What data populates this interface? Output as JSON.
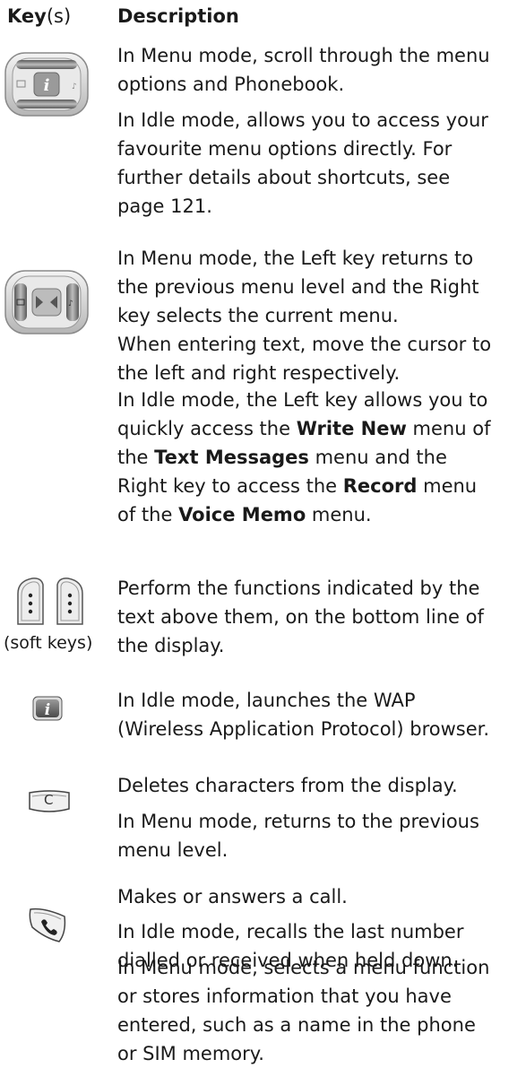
{
  "header": {
    "key_bold": "Key",
    "key_suffix": "(s)",
    "description": "Description"
  },
  "rows": {
    "nav_updown": {
      "p1": "In Menu mode, scroll through the menu\noptions and Phonebook.",
      "p2": "In Idle mode, allows you to access your\nfavourite menu options directly. For\nfurther details about shortcuts, see\npage 121."
    },
    "nav_leftright": {
      "p1": "In Menu mode, the Left key returns to\nthe previous menu level and the Right\nkey selects the current menu.\nWhen entering text, move the cursor to\nthe left and right respectively.",
      "p2_a": "In Idle mode, the Left key allows you to\nquickly access the ",
      "p2_b": "Write New",
      "p2_c": " menu of\nthe ",
      "p2_d": "Text Messages",
      "p2_e": " menu and the\nRight key to access the ",
      "p2_f": "Record",
      "p2_g": " menu\nof the ",
      "p2_h": "Voice Memo",
      "p2_i": " menu."
    },
    "soft_keys": {
      "caption": "(soft keys)",
      "p1": "Perform the functions indicated by the\ntext above them, on the bottom line of\nthe display."
    },
    "wap_key": {
      "p1": "In Idle mode, launches the WAP\n(Wireless Application Protocol) browser."
    },
    "c_key": {
      "label": "C",
      "p1": "Deletes characters from the display.",
      "p2": "In Menu mode, returns to the previous\nmenu level."
    },
    "send_key": {
      "p1": "Makes or answers a call.",
      "p2": "In Idle mode, recalls the last number\ndialled or received when held down.",
      "p3": "In Menu mode, selects a menu function\nor stores information that you have\nentered, such as a name in the phone\nor SIM memory."
    }
  }
}
